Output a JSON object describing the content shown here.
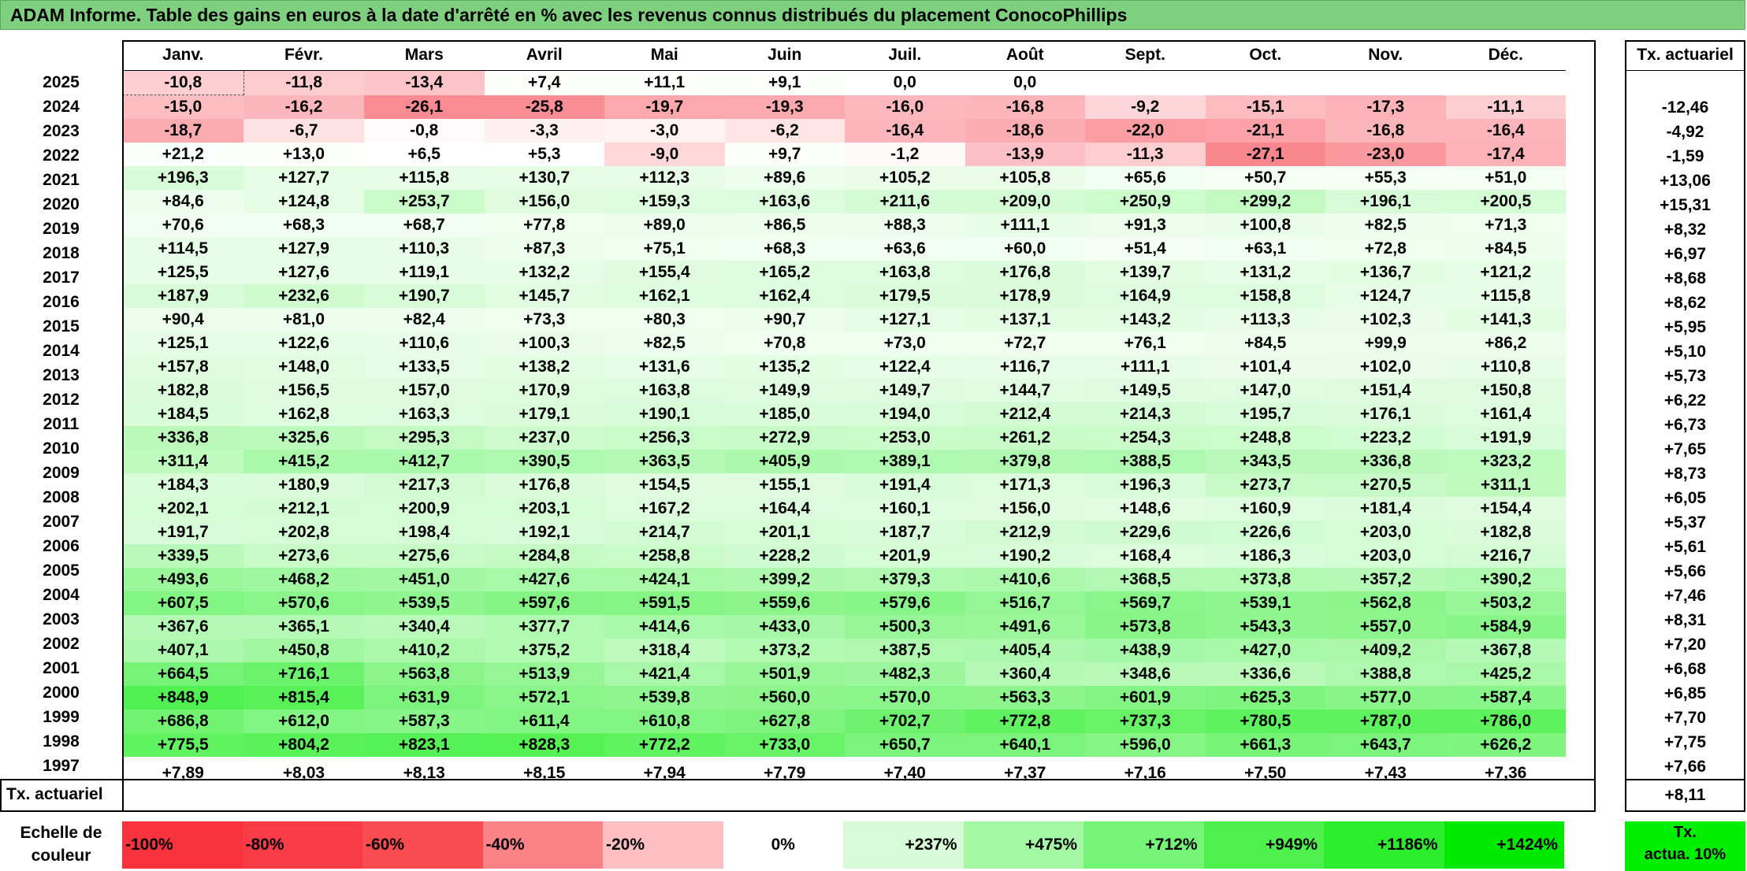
{
  "title": "ADAM Informe. Table des gains en euros à la date d'arrêté en % avec les revenus connus distribués du placement ConocoPhillips",
  "months": [
    "Janv.",
    "Févr.",
    "Mars",
    "Avril",
    "Mai",
    "Juin",
    "Juil.",
    "Août",
    "Sept.",
    "Oct.",
    "Nov.",
    "Déc."
  ],
  "right_header": "Tx. actuariel",
  "rows": [
    {
      "year": "2025",
      "values": [
        "-10,8",
        "-11,8",
        "-13,4",
        "+7,4",
        "+11,1",
        "+9,1",
        "0,0",
        "0,0",
        "",
        "",
        "",
        ""
      ],
      "tx": ""
    },
    {
      "year": "2024",
      "values": [
        "-15,0",
        "-16,2",
        "-26,1",
        "-25,8",
        "-19,7",
        "-19,3",
        "-16,0",
        "-16,8",
        "-9,2",
        "-15,1",
        "-17,3",
        "-11,1"
      ],
      "tx": "-12,46"
    },
    {
      "year": "2023",
      "values": [
        "-18,7",
        "-6,7",
        "-0,8",
        "-3,3",
        "-3,0",
        "-6,2",
        "-16,4",
        "-18,6",
        "-22,0",
        "-21,1",
        "-16,8",
        "-16,4"
      ],
      "tx": "-4,92"
    },
    {
      "year": "2022",
      "values": [
        "+21,2",
        "+13,0",
        "+6,5",
        "+5,3",
        "-9,0",
        "+9,7",
        "-1,2",
        "-13,9",
        "-11,3",
        "-27,1",
        "-23,0",
        "-17,4"
      ],
      "tx": "-1,59"
    },
    {
      "year": "2021",
      "values": [
        "+196,3",
        "+127,7",
        "+115,8",
        "+130,7",
        "+112,3",
        "+89,6",
        "+105,2",
        "+105,8",
        "+65,6",
        "+50,7",
        "+55,3",
        "+51,0"
      ],
      "tx": "+13,06"
    },
    {
      "year": "2020",
      "values": [
        "+84,6",
        "+124,8",
        "+253,7",
        "+156,0",
        "+159,3",
        "+163,6",
        "+211,6",
        "+209,0",
        "+250,9",
        "+299,2",
        "+196,1",
        "+200,5"
      ],
      "tx": "+15,31"
    },
    {
      "year": "2019",
      "values": [
        "+70,6",
        "+68,3",
        "+68,7",
        "+77,8",
        "+89,0",
        "+86,5",
        "+88,3",
        "+111,1",
        "+91,3",
        "+100,8",
        "+82,5",
        "+71,3"
      ],
      "tx": "+8,32"
    },
    {
      "year": "2018",
      "values": [
        "+114,5",
        "+127,9",
        "+110,3",
        "+87,3",
        "+75,1",
        "+68,3",
        "+63,6",
        "+60,0",
        "+51,4",
        "+63,1",
        "+72,8",
        "+84,5"
      ],
      "tx": "+6,97"
    },
    {
      "year": "2017",
      "values": [
        "+125,5",
        "+127,6",
        "+119,1",
        "+132,2",
        "+155,4",
        "+165,2",
        "+163,8",
        "+176,8",
        "+139,7",
        "+131,2",
        "+136,7",
        "+121,2"
      ],
      "tx": "+8,68"
    },
    {
      "year": "2016",
      "values": [
        "+187,9",
        "+232,6",
        "+190,7",
        "+145,7",
        "+162,1",
        "+162,4",
        "+179,5",
        "+178,9",
        "+164,9",
        "+158,8",
        "+124,7",
        "+115,8"
      ],
      "tx": "+8,62"
    },
    {
      "year": "2015",
      "values": [
        "+90,4",
        "+81,0",
        "+82,4",
        "+73,3",
        "+80,3",
        "+90,7",
        "+127,1",
        "+137,1",
        "+143,2",
        "+113,3",
        "+102,3",
        "+141,3"
      ],
      "tx": "+5,95"
    },
    {
      "year": "2014",
      "values": [
        "+125,1",
        "+122,6",
        "+110,6",
        "+100,3",
        "+82,5",
        "+70,8",
        "+73,0",
        "+72,7",
        "+76,1",
        "+84,5",
        "+99,9",
        "+86,2"
      ],
      "tx": "+5,10"
    },
    {
      "year": "2013",
      "values": [
        "+157,8",
        "+148,0",
        "+133,5",
        "+138,2",
        "+131,6",
        "+135,2",
        "+122,4",
        "+116,7",
        "+111,1",
        "+101,4",
        "+102,0",
        "+110,8"
      ],
      "tx": "+5,73"
    },
    {
      "year": "2012",
      "values": [
        "+182,8",
        "+156,5",
        "+157,0",
        "+170,9",
        "+163,8",
        "+149,9",
        "+149,7",
        "+144,7",
        "+149,5",
        "+147,0",
        "+151,4",
        "+150,8"
      ],
      "tx": "+6,22"
    },
    {
      "year": "2011",
      "values": [
        "+184,5",
        "+162,8",
        "+163,3",
        "+179,1",
        "+190,1",
        "+185,0",
        "+194,0",
        "+212,4",
        "+214,3",
        "+195,7",
        "+176,1",
        "+161,4"
      ],
      "tx": "+6,73"
    },
    {
      "year": "2010",
      "values": [
        "+336,8",
        "+325,6",
        "+295,3",
        "+237,0",
        "+256,3",
        "+272,9",
        "+253,0",
        "+261,2",
        "+254,3",
        "+248,8",
        "+223,2",
        "+191,9"
      ],
      "tx": "+7,65"
    },
    {
      "year": "2009",
      "values": [
        "+311,4",
        "+415,2",
        "+412,7",
        "+390,5",
        "+363,5",
        "+405,9",
        "+389,1",
        "+379,8",
        "+388,5",
        "+343,5",
        "+336,8",
        "+323,2"
      ],
      "tx": "+8,73"
    },
    {
      "year": "2008",
      "values": [
        "+184,3",
        "+180,9",
        "+217,3",
        "+176,8",
        "+154,5",
        "+155,1",
        "+191,4",
        "+171,3",
        "+196,3",
        "+273,7",
        "+270,5",
        "+311,1"
      ],
      "tx": "+6,05"
    },
    {
      "year": "2007",
      "values": [
        "+202,1",
        "+212,1",
        "+200,9",
        "+203,1",
        "+167,2",
        "+164,4",
        "+160,1",
        "+156,0",
        "+148,6",
        "+160,9",
        "+181,4",
        "+154,4"
      ],
      "tx": "+5,37"
    },
    {
      "year": "2006",
      "values": [
        "+191,7",
        "+202,8",
        "+198,4",
        "+192,1",
        "+214,7",
        "+201,1",
        "+187,7",
        "+212,9",
        "+229,6",
        "+226,6",
        "+203,0",
        "+182,8"
      ],
      "tx": "+5,61"
    },
    {
      "year": "2005",
      "values": [
        "+339,5",
        "+273,6",
        "+275,6",
        "+284,8",
        "+258,8",
        "+228,2",
        "+201,9",
        "+190,2",
        "+168,4",
        "+186,3",
        "+203,0",
        "+216,7"
      ],
      "tx": "+5,66"
    },
    {
      "year": "2004",
      "values": [
        "+493,6",
        "+468,2",
        "+451,0",
        "+427,6",
        "+424,1",
        "+399,2",
        "+379,3",
        "+410,6",
        "+368,5",
        "+373,8",
        "+357,2",
        "+390,2"
      ],
      "tx": "+7,46"
    },
    {
      "year": "2003",
      "values": [
        "+607,5",
        "+570,6",
        "+539,5",
        "+597,6",
        "+591,5",
        "+559,6",
        "+579,6",
        "+516,7",
        "+569,7",
        "+539,1",
        "+562,8",
        "+503,2"
      ],
      "tx": "+8,31"
    },
    {
      "year": "2002",
      "values": [
        "+367,6",
        "+365,1",
        "+340,4",
        "+377,7",
        "+414,6",
        "+433,0",
        "+500,3",
        "+491,6",
        "+573,8",
        "+543,3",
        "+557,0",
        "+584,9"
      ],
      "tx": "+7,20"
    },
    {
      "year": "2001",
      "values": [
        "+407,1",
        "+450,8",
        "+410,2",
        "+375,2",
        "+318,4",
        "+373,2",
        "+387,5",
        "+405,4",
        "+438,9",
        "+427,0",
        "+409,2",
        "+367,8"
      ],
      "tx": "+6,68"
    },
    {
      "year": "2000",
      "values": [
        "+664,5",
        "+716,1",
        "+563,8",
        "+513,9",
        "+421,4",
        "+501,9",
        "+482,3",
        "+360,4",
        "+348,6",
        "+336,6",
        "+388,8",
        "+425,2"
      ],
      "tx": "+6,85"
    },
    {
      "year": "1999",
      "values": [
        "+848,9",
        "+815,4",
        "+631,9",
        "+572,1",
        "+539,8",
        "+560,0",
        "+570,0",
        "+563,3",
        "+601,9",
        "+625,3",
        "+577,0",
        "+587,4"
      ],
      "tx": "+7,70"
    },
    {
      "year": "1998",
      "values": [
        "+686,8",
        "+612,0",
        "+587,3",
        "+611,4",
        "+610,8",
        "+627,8",
        "+702,7",
        "+772,8",
        "+737,3",
        "+780,5",
        "+787,0",
        "+786,0"
      ],
      "tx": "+7,75"
    },
    {
      "year": "1997",
      "values": [
        "+775,5",
        "+804,2",
        "+823,1",
        "+828,3",
        "+772,2",
        "+733,0",
        "+650,7",
        "+640,1",
        "+596,0",
        "+661,3",
        "+643,7",
        "+626,2"
      ],
      "tx": "+7,66"
    }
  ],
  "tx_row": {
    "label": "Tx. actuariel",
    "values": [
      "+7,89",
      "+8,03",
      "+8,13",
      "+8,15",
      "+7,94",
      "+7,79",
      "+7,40",
      "+7,37",
      "+7,16",
      "+7,50",
      "+7,43",
      "+7,36"
    ],
    "total": "+8,11"
  },
  "scale": {
    "label_line1": "Echelle de",
    "label_line2": "couleur",
    "items": [
      {
        "text": "-100%",
        "color": "#f8323c",
        "kind": "neg"
      },
      {
        "text": "-80%",
        "color": "#f83c46",
        "kind": "neg"
      },
      {
        "text": "-60%",
        "color": "#fa4b50",
        "kind": "neg"
      },
      {
        "text": "-40%",
        "color": "#fb8287",
        "kind": "neg"
      },
      {
        "text": "-20%",
        "color": "#fdbfc2",
        "kind": "neg"
      },
      {
        "text": "0%",
        "color": "#ffffff",
        "kind": "zero"
      },
      {
        "text": "+237%",
        "color": "#d6fbd6",
        "kind": "pos"
      },
      {
        "text": "+475%",
        "color": "#a4f8a4",
        "kind": "pos"
      },
      {
        "text": "+712%",
        "color": "#76f476",
        "kind": "pos"
      },
      {
        "text": "+949%",
        "color": "#4ef04e",
        "kind": "pos"
      },
      {
        "text": "+1186%",
        "color": "#2dec2d",
        "kind": "pos"
      },
      {
        "text": "+1424%",
        "color": "#00ea00",
        "kind": "pos"
      }
    ],
    "right_line1": "Tx.",
    "right_line2": "actua. 10%"
  }
}
